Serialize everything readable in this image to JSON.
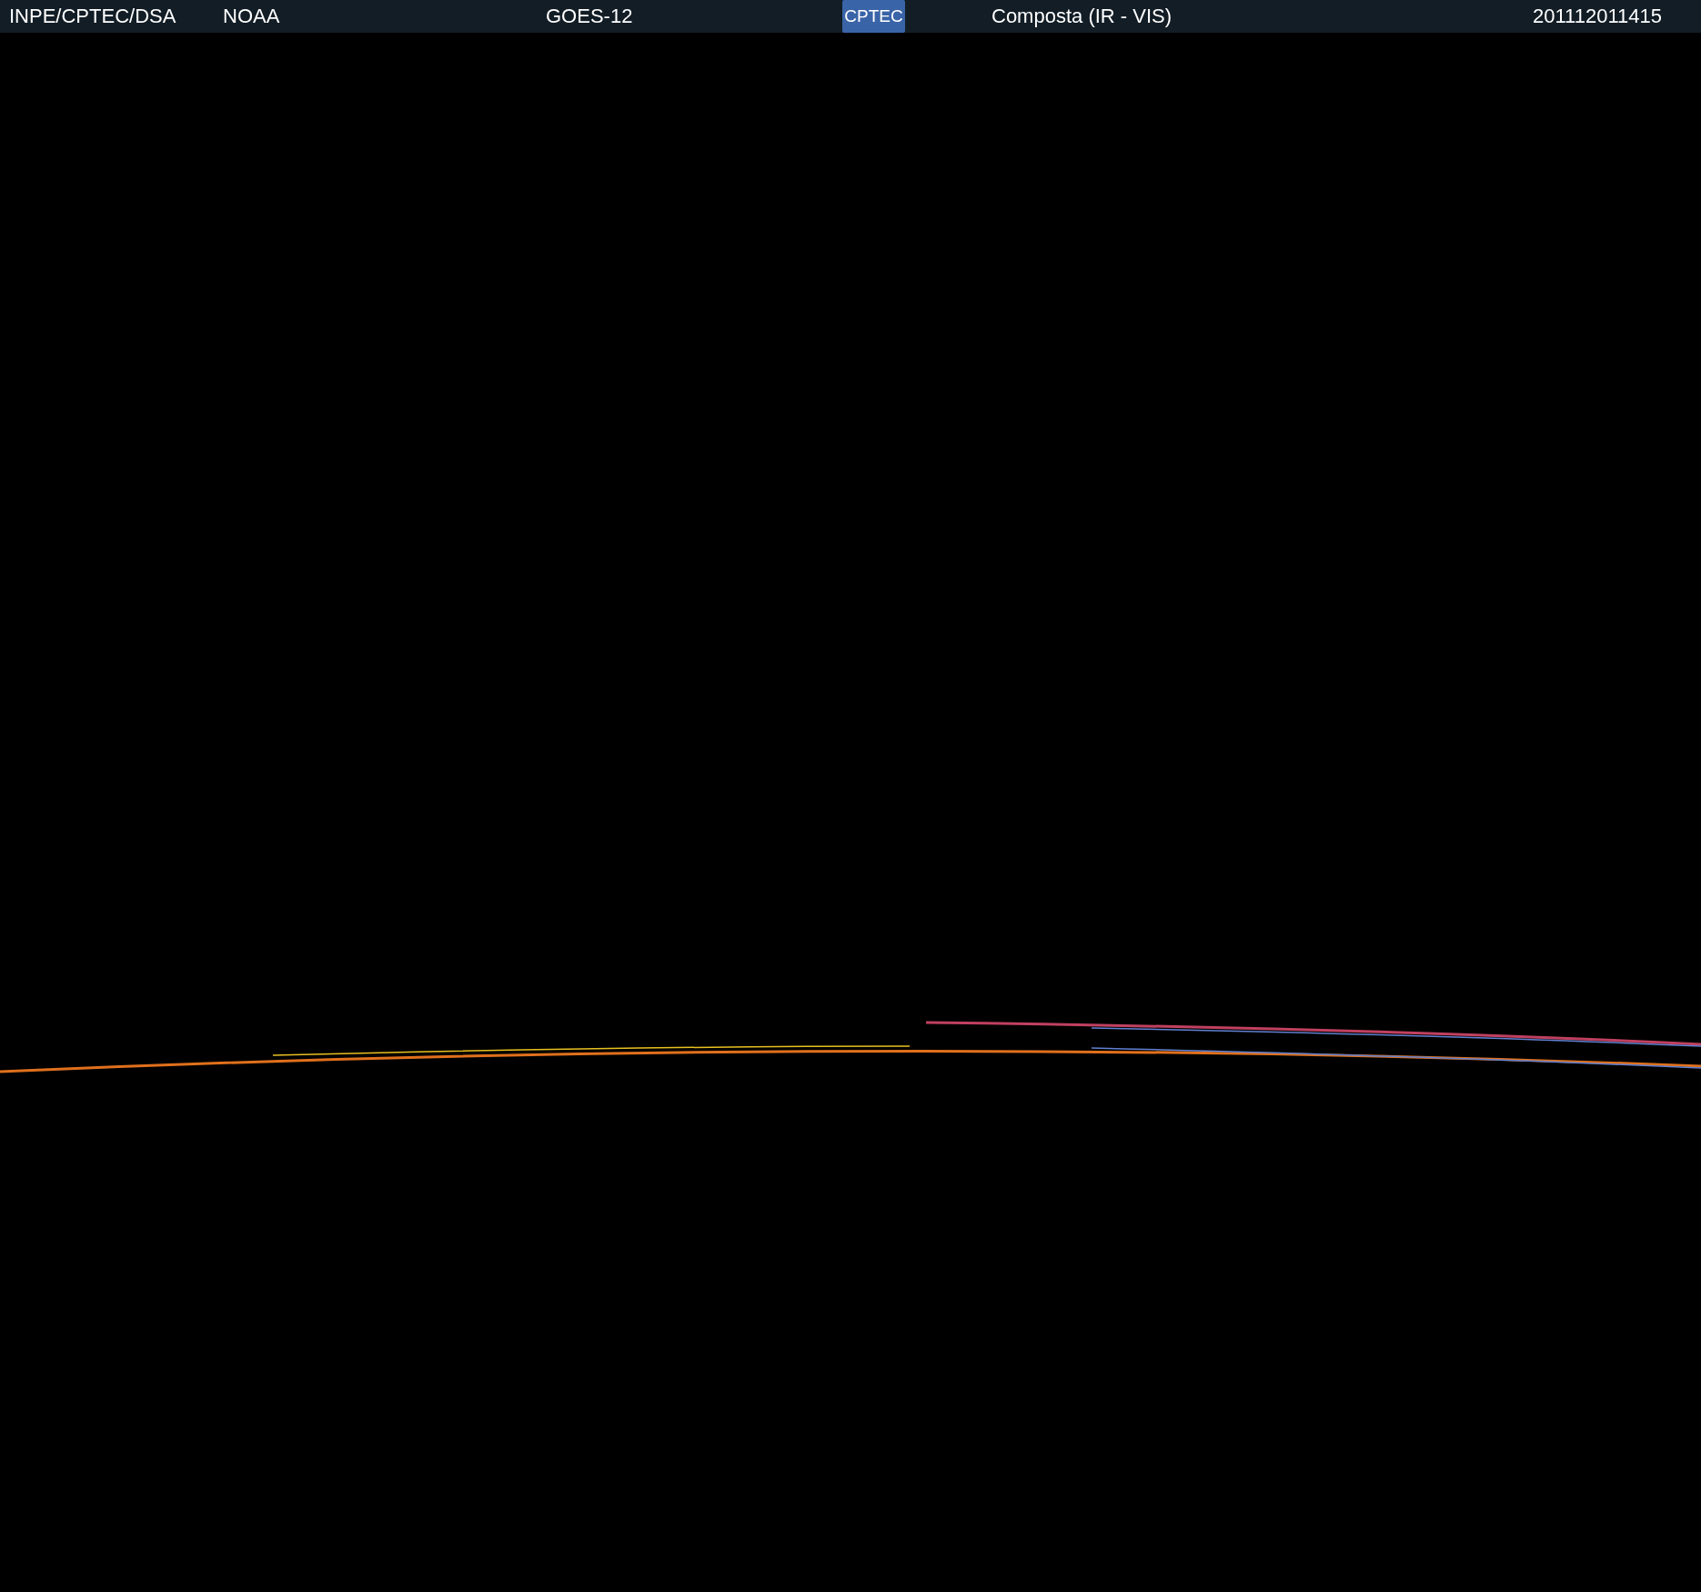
{
  "header": {
    "source": "INPE/CPTEC/DSA",
    "agency": "NOAA",
    "satellite": "GOES-12",
    "logo_text": "CPTEC",
    "product": "Composta (IR - VIS)",
    "timestamp": "201112011415"
  }
}
